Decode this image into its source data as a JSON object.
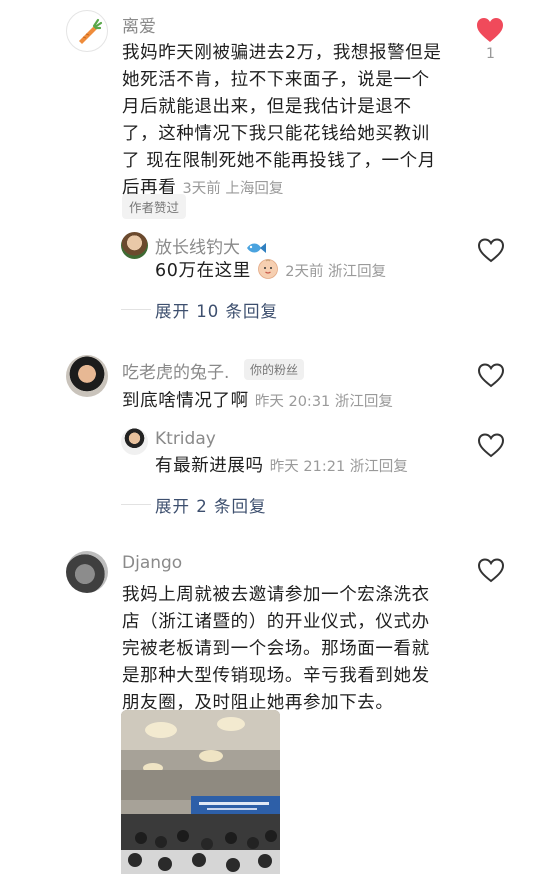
{
  "comments": [
    {
      "author": "离爱",
      "text_lines": [
        "我妈昨天刚被骗进去2万，我想报警但是",
        "她死活不肯，拉不下来面子，说是一个",
        "月后就能退出来，但是我估计是退不",
        "了，这种情况下我只能花钱给她买教训",
        "了 现在限制死她不能再投钱了，一个月"
      ],
      "last_line": "后再看",
      "meta": "3天前 上海",
      "reply": "回复",
      "badge": "作者赞过",
      "likes": "1",
      "liked": true,
      "avatar_icon": "carrot-icon"
    },
    {
      "author": "放长线钓大",
      "author_emoji": "fish-emoji",
      "text": "60万在这里",
      "text_emoji": "baby-emoji",
      "meta": "2天前 浙江",
      "reply": "回复",
      "expand": "展开 10 条回复"
    },
    {
      "author": "吃老虎的兔子.",
      "fan_badge": "你的粉丝",
      "text": "到底啥情况了啊",
      "meta": "昨天 20:31 浙江",
      "reply": "回复"
    },
    {
      "author": "Ktriday",
      "text": "有最新进展吗",
      "meta": "昨天 21:21 浙江",
      "reply": "回复",
      "expand": "展开 2 条回复"
    },
    {
      "author": "Django",
      "text_lines": [
        "我妈上周就被去邀请参加一个宏涤洗衣",
        "店（浙江诸暨的）的开业仪式，仪式办",
        "完被老板请到一个会场。那场面一看就",
        "是那种大型传销现场。辛亏我看到她发",
        "朋友圈，及时阻止她再参加下去。"
      ]
    }
  ],
  "colors": {
    "heart_active": "#f04a5b",
    "link": "#3d4f6e",
    "meta": "#9a9a9a"
  }
}
